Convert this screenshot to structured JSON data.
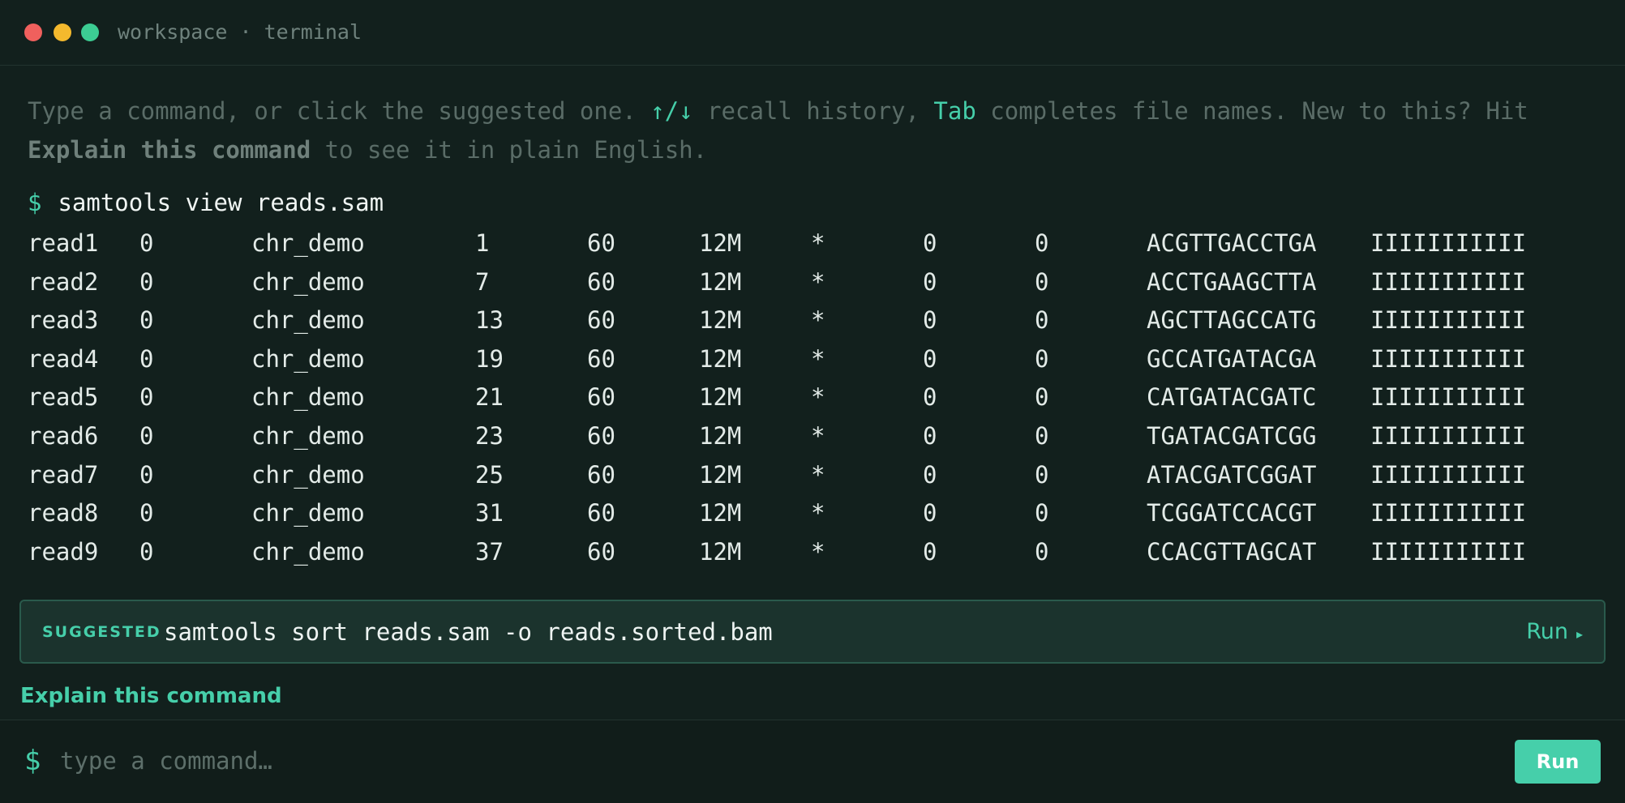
{
  "window": {
    "title": "workspace · terminal"
  },
  "hint": {
    "text1": "Type a command, or click the suggested one. ",
    "arrows": "↑/↓",
    "text2": " recall history, ",
    "tab_key": "Tab",
    "text3": " completes file names. New to this? Hit ",
    "explain_bold": "Explain this command",
    "text4": " to see it in plain English."
  },
  "history": {
    "prompt": "$",
    "command": "samtools view reads.sam"
  },
  "output_rows": [
    [
      "read1",
      "0",
      "chr_demo",
      "1",
      "60",
      "12M",
      "*",
      "0",
      "0",
      "ACGTTGACCTGA",
      "IIIIIIIIIII"
    ],
    [
      "read2",
      "0",
      "chr_demo",
      "7",
      "60",
      "12M",
      "*",
      "0",
      "0",
      "ACCTGAAGCTTA",
      "IIIIIIIIIII"
    ],
    [
      "read3",
      "0",
      "chr_demo",
      "13",
      "60",
      "12M",
      "*",
      "0",
      "0",
      "AGCTTAGCCATG",
      "IIIIIIIIIII"
    ],
    [
      "read4",
      "0",
      "chr_demo",
      "19",
      "60",
      "12M",
      "*",
      "0",
      "0",
      "GCCATGATACGA",
      "IIIIIIIIIII"
    ],
    [
      "read5",
      "0",
      "chr_demo",
      "21",
      "60",
      "12M",
      "*",
      "0",
      "0",
      "CATGATACGATC",
      "IIIIIIIIIII"
    ],
    [
      "read6",
      "0",
      "chr_demo",
      "23",
      "60",
      "12M",
      "*",
      "0",
      "0",
      "TGATACGATCGG",
      "IIIIIIIIIII"
    ],
    [
      "read7",
      "0",
      "chr_demo",
      "25",
      "60",
      "12M",
      "*",
      "0",
      "0",
      "ATACGATCGGAT",
      "IIIIIIIIIII"
    ],
    [
      "read8",
      "0",
      "chr_demo",
      "31",
      "60",
      "12M",
      "*",
      "0",
      "0",
      "TCGGATCCACGT",
      "IIIIIIIIIII"
    ],
    [
      "read9",
      "0",
      "chr_demo",
      "37",
      "60",
      "12M",
      "*",
      "0",
      "0",
      "CCACGTTAGCAT",
      "IIIIIIIIIII"
    ]
  ],
  "suggestion": {
    "tag": "SUGGESTED",
    "command": "samtools sort reads.sam -o reads.sorted.bam",
    "run_label": "Run",
    "run_icon": "▸"
  },
  "explain_link": "Explain this command",
  "input": {
    "prompt": "$",
    "placeholder": "type a command…",
    "run_label": "Run"
  },
  "colors": {
    "background": "#12201d",
    "accent": "#46cfaa",
    "dot_red": "#f0605d",
    "dot_yellow": "#f4b92d",
    "dot_green": "#3ccd93"
  }
}
